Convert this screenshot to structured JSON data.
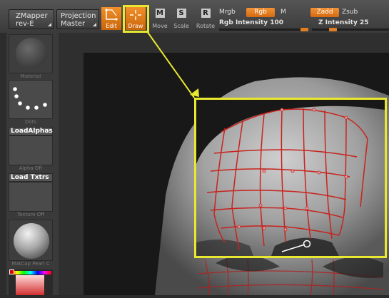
{
  "toolbar": {
    "plugin_label": "ZMapper",
    "plugin_sub": "rev-E",
    "projection_label": "Projection",
    "projection_sub": "Master",
    "tools": [
      {
        "label": "Edit",
        "letter": "",
        "active": true
      },
      {
        "label": "Draw",
        "letter": "",
        "active": true
      },
      {
        "label": "Move",
        "letter": "M",
        "active": false
      },
      {
        "label": "Scale",
        "letter": "S",
        "active": false
      },
      {
        "label": "Rotate",
        "letter": "R",
        "active": false
      }
    ],
    "mrgb_label": "Mrgb",
    "rgb_label": "Rgb",
    "m_label": "M",
    "rgb_intensity_label": "Rgb Intensity",
    "rgb_intensity_value": "100",
    "zadd_label": "Zadd",
    "zsub_label": "Zsub",
    "z_intensity_label": "Z Intensity",
    "z_intensity_value": "25",
    "rgb_intensity_level": 1.0,
    "z_intensity_level": 0.25
  },
  "sidebar": {
    "material_label": "Material",
    "stroke_label": "Dots",
    "alpha_title": "LoadAlphas",
    "alpha_label": "Alpha Off",
    "texture_title": "Load Txtrs",
    "texture_label": "Texture Off",
    "matcap_label": "MatCap Pearl C"
  },
  "colors": {
    "accent": "#f0882a",
    "highlight": "#e8e830",
    "mesh_lines": "#c8231e"
  },
  "icons": {
    "edit": "edit-icon",
    "draw": "draw-crosshair-icon",
    "move": "move-icon",
    "scale": "scale-icon",
    "rotate": "rotate-icon"
  }
}
